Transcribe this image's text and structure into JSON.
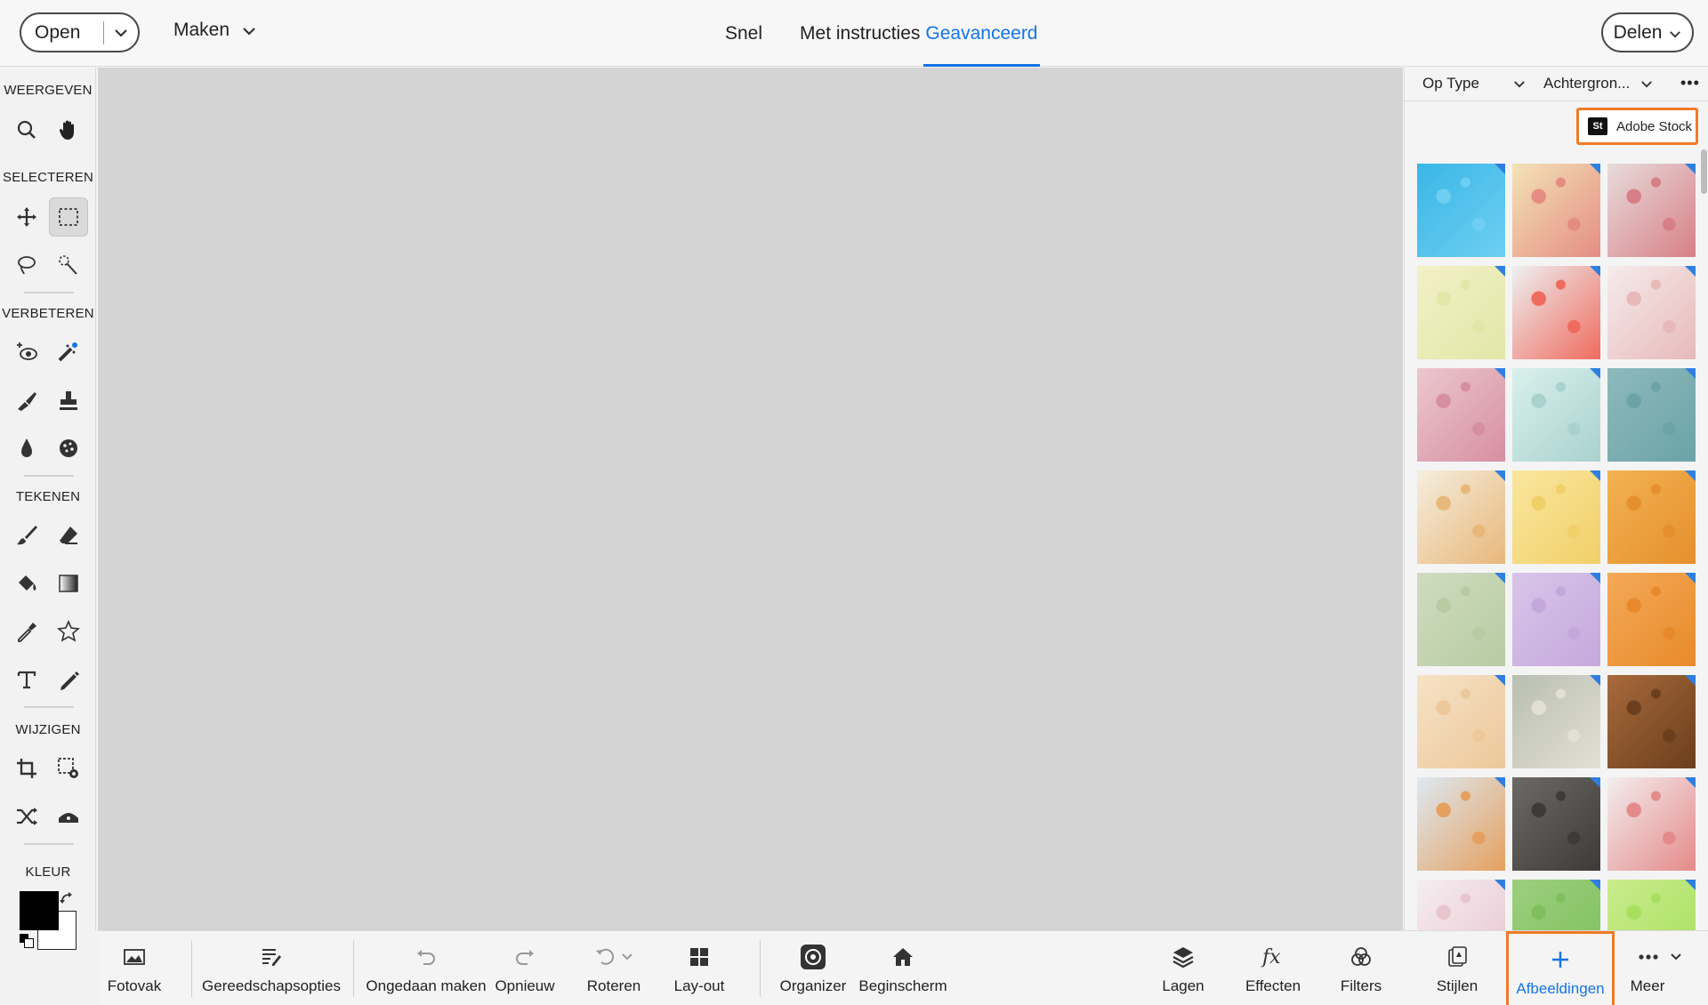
{
  "topbar": {
    "open_label": "Open",
    "maken_label": "Maken",
    "modes": {
      "snel": "Snel",
      "met_instructies": "Met instructies",
      "geavanceerd": "Geavanceerd"
    },
    "delen_label": "Delen"
  },
  "toolbar": {
    "sections": {
      "weergeven": "WEERGEVEN",
      "selecteren": "SELECTEREN",
      "verbeteren": "VERBETEREN",
      "tekenen": "TEKENEN",
      "wijzigen": "WIJZIGEN",
      "kleur": "KLEUR"
    },
    "foreground_color": "#000000",
    "background_color": "#ffffff"
  },
  "panel": {
    "filter_type": "Op Type",
    "filter_category": "Achtergron...",
    "stock_logo": "St",
    "stock_label": "Adobe Stock",
    "thumbnails": [
      {
        "name": "blue-butterfly",
        "colors": [
          "#39b6e6",
          "#6fcff2"
        ]
      },
      {
        "name": "floral-circles",
        "colors": [
          "#f3e3b7",
          "#e58d83"
        ]
      },
      {
        "name": "pink-grey-watercolor",
        "colors": [
          "#e8dcdc",
          "#d77f86"
        ]
      },
      {
        "name": "yellow-mandala",
        "colors": [
          "#f3f0c7",
          "#e2e7a8"
        ]
      },
      {
        "name": "tulip-border",
        "colors": [
          "#eef0f1",
          "#ef6b5e"
        ]
      },
      {
        "name": "pink-flowers-light",
        "colors": [
          "#f6ecec",
          "#e7b9b9"
        ]
      },
      {
        "name": "pink-dots",
        "colors": [
          "#ecc7cf",
          "#d68fa0"
        ]
      },
      {
        "name": "mint-branches",
        "colors": [
          "#d9f0ec",
          "#a9d2cf"
        ]
      },
      {
        "name": "teal-dots",
        "colors": [
          "#8db9bc",
          "#6ba3a8"
        ]
      },
      {
        "name": "swirl-circles",
        "colors": [
          "#f5eede",
          "#e8b77a"
        ]
      },
      {
        "name": "yellow-pink-dots",
        "colors": [
          "#f9e79e",
          "#f1cf69"
        ]
      },
      {
        "name": "orange-dots",
        "colors": [
          "#f3b252",
          "#e58f2d"
        ]
      },
      {
        "name": "green-stripes",
        "colors": [
          "#cfdcbf",
          "#b7cba3"
        ]
      },
      {
        "name": "purple-blocks",
        "colors": [
          "#d9c5e9",
          "#c4a8dc"
        ]
      },
      {
        "name": "orange-grunge",
        "colors": [
          "#f4a957",
          "#e88a2b"
        ]
      },
      {
        "name": "cream-dots",
        "colors": [
          "#f6e2c5",
          "#ecc89b"
        ]
      },
      {
        "name": "grey-foggy",
        "colors": [
          "#b9bfb1",
          "#e2dfd3"
        ]
      },
      {
        "name": "brown-grunge",
        "colors": [
          "#a86a3b",
          "#6b3e1d"
        ]
      },
      {
        "name": "autumn-leaves",
        "colors": [
          "#dde9f2",
          "#e5a05f"
        ]
      },
      {
        "name": "wood-planks",
        "colors": [
          "#6c6a66",
          "#3d3b37"
        ]
      },
      {
        "name": "pink-drops",
        "colors": [
          "#f3eded",
          "#e58a8a"
        ]
      },
      {
        "name": "pink-birds",
        "colors": [
          "#f5eef0",
          "#e8c5cf"
        ]
      },
      {
        "name": "green-pattern",
        "colors": [
          "#9ccf7e",
          "#7fbf5d"
        ]
      },
      {
        "name": "lime-pattern",
        "colors": [
          "#c9ec8c",
          "#a8df5f"
        ]
      }
    ]
  },
  "bottombar": {
    "fotovak": "Fotovak",
    "gereedschapsopties": "Gereedschapsopties",
    "ongedaan_maken": "Ongedaan maken",
    "opnieuw": "Opnieuw",
    "roteren": "Roteren",
    "lay_out": "Lay-out",
    "organizer": "Organizer",
    "beginscherm": "Beginscherm",
    "lagen": "Lagen",
    "effecten": "Effecten",
    "filters": "Filters",
    "stijlen": "Stijlen",
    "afbeeldingen": "Afbeeldingen",
    "meer": "Meer"
  },
  "colors": {
    "accent": "#1473e6",
    "highlight": "#f07a2a"
  }
}
